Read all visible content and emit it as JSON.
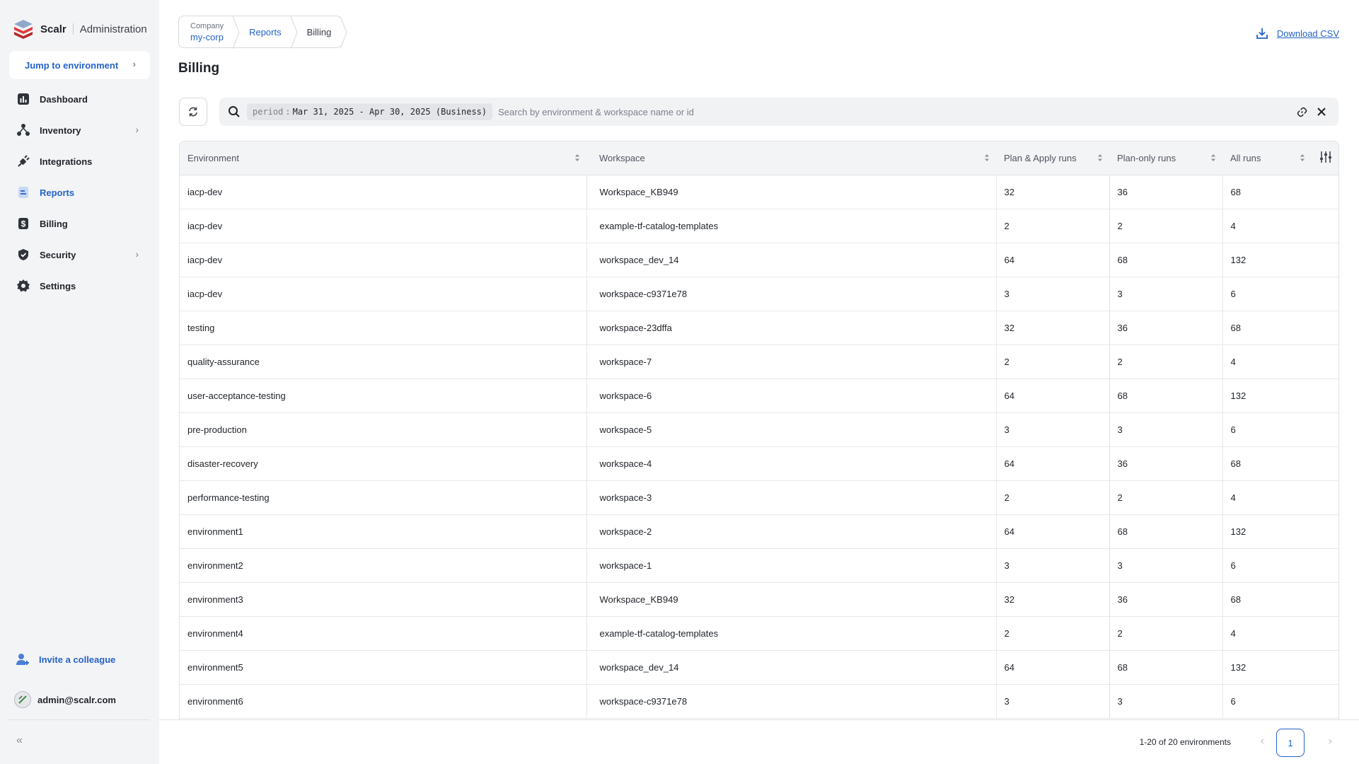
{
  "brand": {
    "name": "Scalr",
    "section": "Administration"
  },
  "sidebar": {
    "jump_label": "Jump to environment",
    "items": [
      {
        "label": "Dashboard"
      },
      {
        "label": "Inventory"
      },
      {
        "label": "Integrations"
      },
      {
        "label": "Reports"
      },
      {
        "label": "Billing"
      },
      {
        "label": "Security"
      },
      {
        "label": "Settings"
      }
    ],
    "invite_label": "Invite a colleague",
    "user_email": "admin@scalr.com"
  },
  "breadcrumb": {
    "company_caption": "Company",
    "company": "my-corp",
    "reports": "Reports",
    "current": "Billing"
  },
  "header": {
    "title": "Billing",
    "download_label": "Download CSV"
  },
  "search": {
    "chip_key": "period",
    "chip_value": "Mar 31, 2025 - Apr 30, 2025 (Business)",
    "placeholder": "Search by environment & workspace name or id"
  },
  "table": {
    "columns": {
      "environment": "Environment",
      "workspace": "Workspace",
      "plan_apply": "Plan & Apply runs",
      "plan_only": "Plan-only runs",
      "all_runs": "All runs"
    },
    "rows": [
      {
        "env": "iacp-dev",
        "ws": "Workspace_KB949",
        "pa": "32",
        "po": "36",
        "all": "68"
      },
      {
        "env": "iacp-dev",
        "ws": "example-tf-catalog-templates",
        "pa": "2",
        "po": "2",
        "all": "4"
      },
      {
        "env": "iacp-dev",
        "ws": "workspace_dev_14",
        "pa": "64",
        "po": "68",
        "all": "132"
      },
      {
        "env": "iacp-dev",
        "ws": "workspace-c9371e78",
        "pa": "3",
        "po": "3",
        "all": "6"
      },
      {
        "env": "testing",
        "ws": "workspace-23dffa",
        "pa": "32",
        "po": "36",
        "all": "68"
      },
      {
        "env": "quality-assurance",
        "ws": "workspace-7",
        "pa": "2",
        "po": "2",
        "all": "4"
      },
      {
        "env": "user-acceptance-testing",
        "ws": "workspace-6",
        "pa": "64",
        "po": "68",
        "all": "132"
      },
      {
        "env": "pre-production",
        "ws": "workspace-5",
        "pa": "3",
        "po": "3",
        "all": "6"
      },
      {
        "env": "disaster-recovery",
        "ws": "workspace-4",
        "pa": "64",
        "po": "36",
        "all": "68"
      },
      {
        "env": "performance-testing",
        "ws": "workspace-3",
        "pa": "2",
        "po": "2",
        "all": "4"
      },
      {
        "env": "environment1",
        "ws": "workspace-2",
        "pa": "64",
        "po": "68",
        "all": "132"
      },
      {
        "env": "environment2",
        "ws": "workspace-1",
        "pa": "3",
        "po": "3",
        "all": "6"
      },
      {
        "env": "environment3",
        "ws": "Workspace_KB949",
        "pa": "32",
        "po": "36",
        "all": "68"
      },
      {
        "env": "environment4",
        "ws": "example-tf-catalog-templates",
        "pa": "2",
        "po": "2",
        "all": "4"
      },
      {
        "env": "environment5",
        "ws": "workspace_dev_14",
        "pa": "64",
        "po": "68",
        "all": "132"
      },
      {
        "env": "environment6",
        "ws": "workspace-c9371e78",
        "pa": "3",
        "po": "3",
        "all": "6"
      }
    ]
  },
  "pagination": {
    "summary": "1-20 of 20 environments",
    "current_page": "1"
  },
  "colors": {
    "accent": "#2563c9",
    "sidebar_bg": "#f3f4f6"
  }
}
